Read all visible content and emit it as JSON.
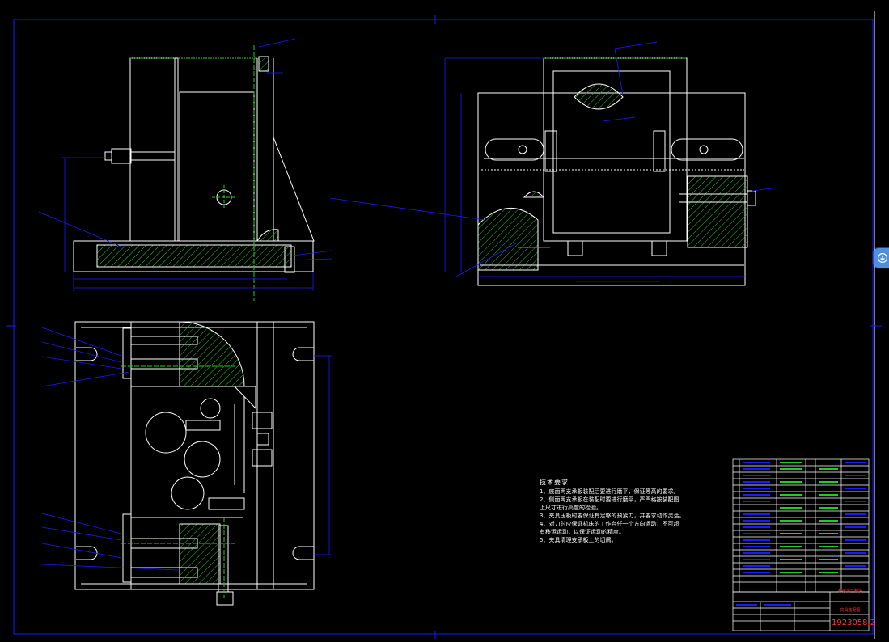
{
  "technical_requirements": {
    "title": "技术要求",
    "items": [
      "1、底面两支承板装配后要进行磨平，保证等高的要求。",
      "2、侧面两支承板在装配时要进行磨平，严严格按装配图",
      "上尺寸进行高度的检验。",
      "3、夹具压板时要保证有足够的预紧力，并要求动作灵活。",
      "4、对刀时应保证机床的工作台任一个方向运动，不可超",
      "有移运运动，以保证运动的精度。",
      "5、夹具清理支承板上的切屑。"
    ]
  },
  "title_block": {
    "drawing_number": "1923058.2",
    "part_name": "夹具装配图",
    "company": "机械设计制造"
  },
  "colors": {
    "background": "#000000",
    "outline": "#ffffff",
    "dimension": "#0000ff",
    "centerline": "#00ff00",
    "hatch": "#00cc00",
    "leader": "#3355ff",
    "title_red": "#ff3333",
    "frame_blue": "#0000cc"
  },
  "ui": {
    "scroll_button_icon": "arrow-down-icon"
  }
}
